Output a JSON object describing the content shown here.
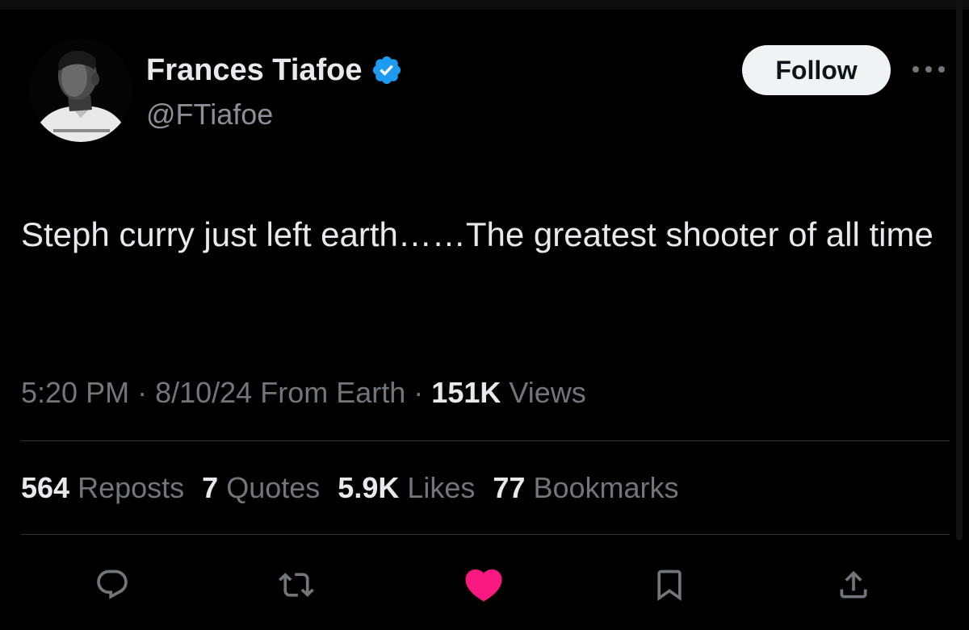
{
  "author": {
    "display_name": "Frances Tiafoe",
    "handle": "@FTiafoe",
    "verified": true,
    "avatar_icon": "profile-photo"
  },
  "follow_label": "Follow",
  "tweet": {
    "text": "Steph curry just left earth……The greatest shooter of all time",
    "time": "5:20 PM",
    "date": "8/10/24",
    "source": "From Earth",
    "views_count": "151K",
    "views_label": "Views"
  },
  "stats": {
    "reposts": {
      "count": "564",
      "label": "Reposts"
    },
    "quotes": {
      "count": "7",
      "label": "Quotes"
    },
    "likes": {
      "count": "5.9K",
      "label": "Likes"
    },
    "bookmarks": {
      "count": "77",
      "label": "Bookmarks"
    }
  },
  "actions": [
    {
      "icon": "reply-icon"
    },
    {
      "icon": "repost-icon"
    },
    {
      "icon": "like-icon",
      "active": true
    },
    {
      "icon": "bookmark-icon"
    },
    {
      "icon": "share-icon"
    }
  ],
  "colors": {
    "background": "#000000",
    "text_primary": "#e7e9ea",
    "text_secondary": "#71767b",
    "verified_blue": "#1d9bf0",
    "like_pink": "#f91880",
    "divider": "#2f3336"
  }
}
